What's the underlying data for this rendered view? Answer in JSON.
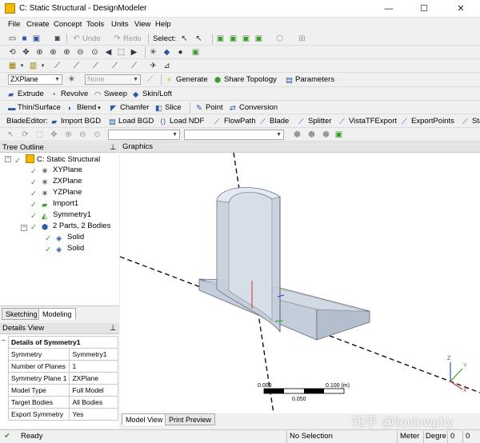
{
  "window": {
    "title": "C: Static Structural - DesignModeler",
    "controls": [
      "—",
      "☐",
      "✕"
    ]
  },
  "menu": [
    "File",
    "Create",
    "Concept",
    "Tools",
    "Units",
    "View",
    "Help"
  ],
  "toolbar1": {
    "undo": "Undo",
    "redo": "Redo",
    "select_label": "Select:"
  },
  "toolbar4": {
    "plane_value": "ZXPlane",
    "sketch_value": "None",
    "generate": "Generate",
    "share_topology": "Share Topology",
    "parameters": "Parameters"
  },
  "toolbar5": {
    "extrude": "Extrude",
    "revolve": "Revolve",
    "sweep": "Sweep",
    "skin_loft": "Skin/Loft"
  },
  "toolbar6": {
    "thin_surface": "Thin/Surface",
    "blend": "Blend",
    "chamfer": "Chamfer",
    "slice": "Slice",
    "point": "Point",
    "conversion": "Conversion"
  },
  "toolbar7": {
    "blade_editor": "BladeEditor:",
    "import_bgd": "Import BGD",
    "load_bgd": "Load BGD",
    "load_ndf": "Load NDF",
    "flowpath": "FlowPath",
    "blade": "Blade",
    "splitter": "Splitter",
    "vistatf_export": "VistaTFExport",
    "export_points": "ExportPoints",
    "sta": "Sta"
  },
  "tree": {
    "header": "Tree Outline",
    "root": "C: Static Structural",
    "items": [
      "XYPlane",
      "ZXPlane",
      "YZPlane",
      "Import1",
      "Symmetry1"
    ],
    "parts": "2 Parts, 2 Bodies",
    "bodies": [
      "Solid",
      "Solid"
    ]
  },
  "left_tabs": [
    "Sketching",
    "Modeling"
  ],
  "details": {
    "header": "Details View",
    "title": "Details of Symmetry1",
    "rows": [
      {
        "key": "Symmetry",
        "value": "Symmetry1"
      },
      {
        "key": "Number of Planes",
        "value": "1"
      },
      {
        "key": "Symmetry Plane 1",
        "value": "ZXPlane"
      },
      {
        "key": "Model Type",
        "value": "Full Model"
      },
      {
        "key": "Target Bodies",
        "value": "All Bodies"
      },
      {
        "key": "Export Symmetry",
        "value": "Yes"
      }
    ]
  },
  "graphics": {
    "header": "Graphics",
    "scale_left": "0.000",
    "scale_right": "0.100 (m)",
    "scale_mid": "0.050",
    "triad": {
      "x": "X",
      "y": "Y",
      "z": "Z"
    }
  },
  "bottom_tabs": [
    "Model View",
    "Print Preview"
  ],
  "status": {
    "ready": "Ready",
    "selection": "No Selection",
    "unit_length": "Meter",
    "unit_angle": "Degre",
    "v1": "0",
    "v2": "0"
  },
  "watermark": "知乎 @ilovlowphy",
  "colors": {
    "accent_green": "#3a9a2a",
    "body_fill": "#c9d3df",
    "window_bg": "#f0f0f0"
  }
}
